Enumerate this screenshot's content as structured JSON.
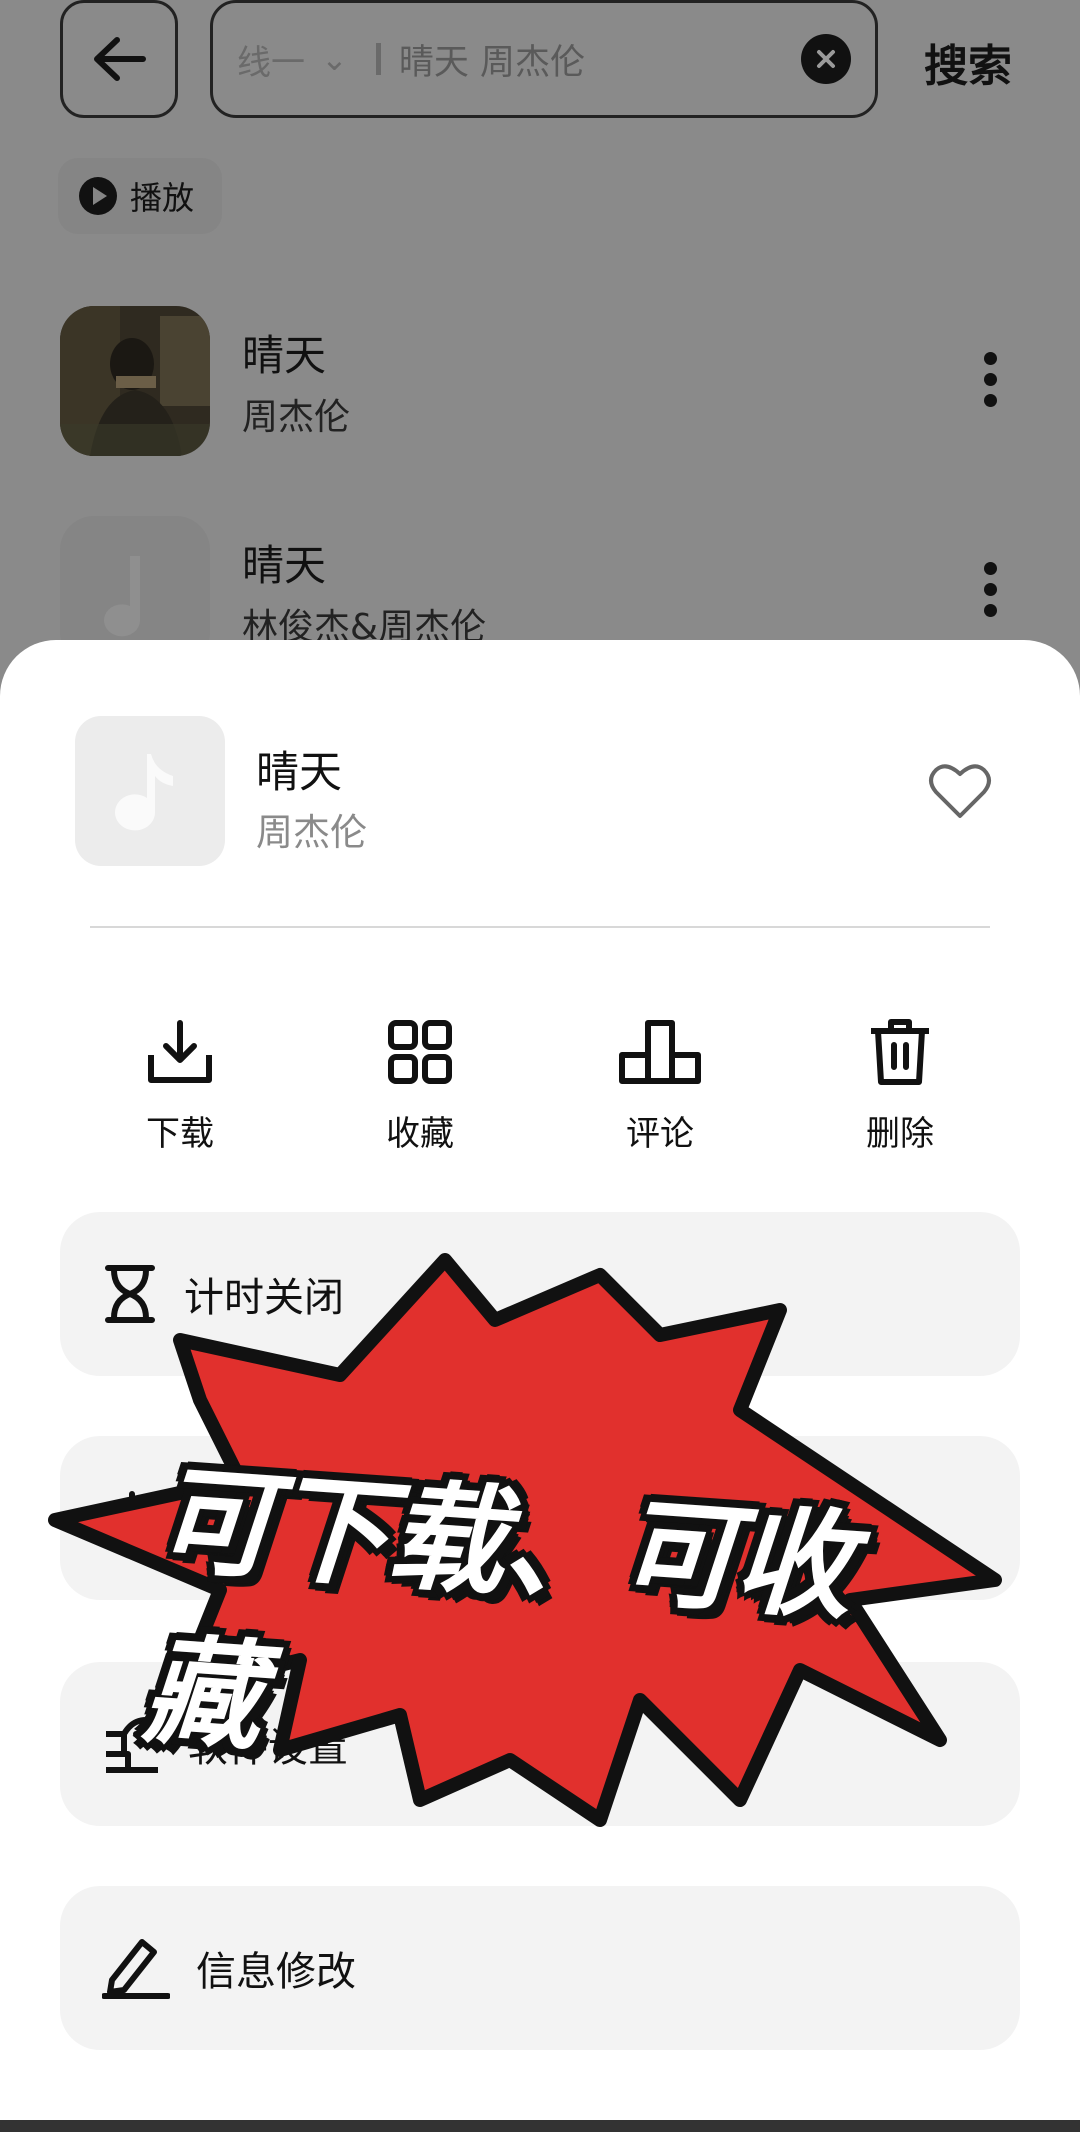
{
  "header": {
    "search_line_label": "线一",
    "search_line_arrow": "⌄",
    "search_query": "晴天 周杰伦",
    "search_button": "搜索"
  },
  "play_all": {
    "label": "播放"
  },
  "results": [
    {
      "title": "晴天",
      "artist": "周杰伦"
    },
    {
      "title": "晴天",
      "artist": "林俊杰&周杰伦"
    }
  ],
  "sheet": {
    "song_title": "晴天",
    "song_artist": "周杰伦",
    "actions": [
      {
        "label": "下载",
        "icon": "download-icon"
      },
      {
        "label": "收藏",
        "icon": "grid-icon"
      },
      {
        "label": "评论",
        "icon": "podium-icon"
      },
      {
        "label": "删除",
        "icon": "trash-icon"
      }
    ],
    "menu": [
      {
        "label": "计时关闭",
        "icon": "hourglass-icon"
      },
      {
        "label": "",
        "icon": "sun-icon"
      },
      {
        "label": "软件设置",
        "icon": "settings-icon"
      },
      {
        "label": "信息修改",
        "icon": "pencil-icon"
      }
    ]
  },
  "overlay": {
    "caption": "可下载、可收藏",
    "burst_color": "#e1302d"
  }
}
